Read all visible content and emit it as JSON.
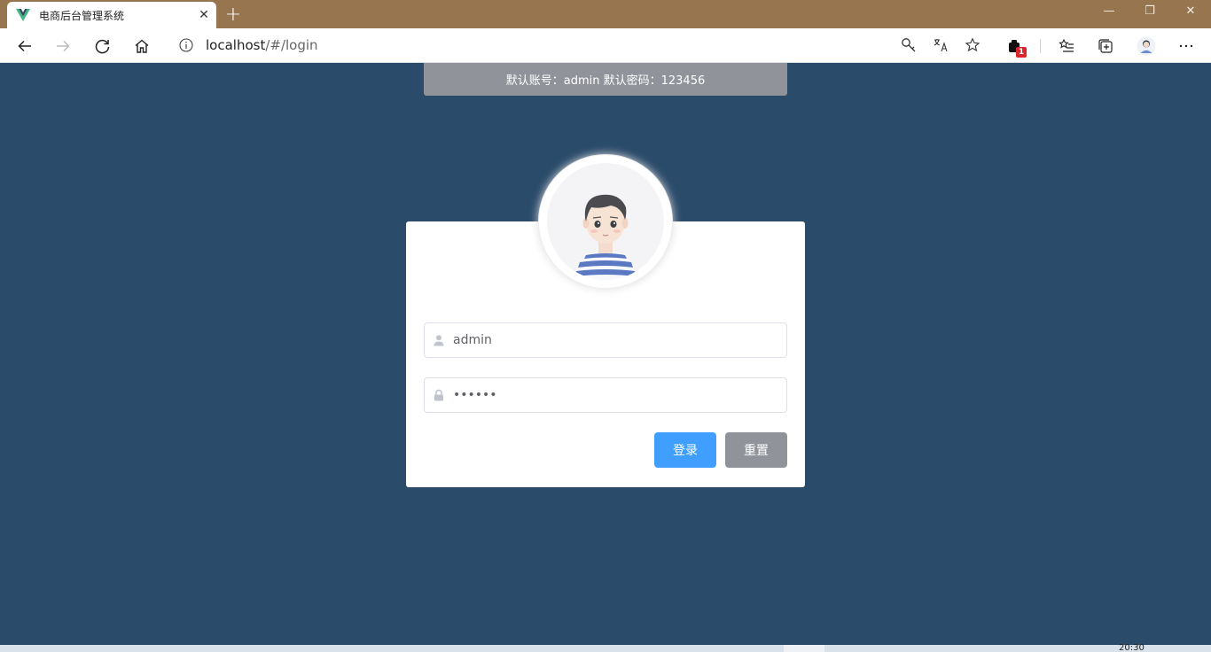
{
  "browser": {
    "tab_title": "电商后台管理系统",
    "tab_close": "✕",
    "new_tab": "+",
    "url_host": "localhost",
    "url_path": "/#/login",
    "notification_count": "1",
    "window_controls": {
      "minimize": "—",
      "restore": "❐",
      "close": "✕"
    }
  },
  "page": {
    "hint": "默认账号：admin 默认密码：123456",
    "username": {
      "value": "admin",
      "icon": "user-icon"
    },
    "password": {
      "value": "123456",
      "icon": "lock-icon"
    },
    "login_label": "登录",
    "reset_label": "重置"
  },
  "colors": {
    "background": "#2b4b6b",
    "primary": "#409eff",
    "info": "#909399",
    "titlebar": "#97754f"
  },
  "taskbar": {
    "clock": "20:30"
  }
}
